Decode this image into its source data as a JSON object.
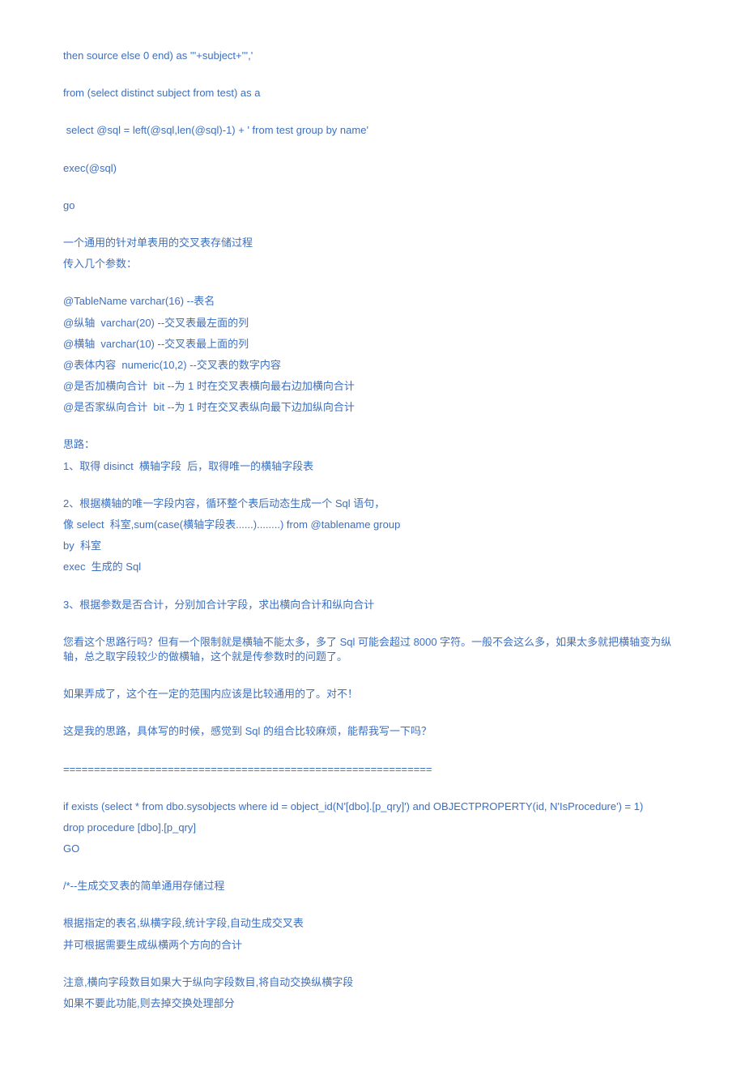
{
  "lines": [
    {
      "text": "then source else 0 end) as '''+subject+''','",
      "class": "blue line"
    },
    {
      "text": "from (select distinct subject from test) as a",
      "class": "blue line"
    },
    {
      "text": " select @sql = left(@sql,len(@sql)-1) + ' from test group by name'",
      "class": "blue line"
    },
    {
      "text": "exec(@sql)",
      "class": "blue line"
    },
    {
      "text": "go",
      "class": "blue line"
    },
    {
      "text": "一个通用的针对单表用的交叉表存储过程",
      "class": "blue line tight"
    },
    {
      "text": "传入几个参数：",
      "class": "blue line"
    },
    {
      "text": "@TableName varchar(16) --表名",
      "class": "blue line tight"
    },
    {
      "text": "@纵轴  varchar(20) --交叉表最左面的列",
      "class": "blue line tight"
    },
    {
      "text": "@横轴  varchar(10) --交叉表最上面的列",
      "class": "blue line tight"
    },
    {
      "text": "@表体内容  numeric(10,2) --交叉表的数字内容",
      "class": "blue line tight"
    },
    {
      "text": "@是否加横向合计  bit --为 1 时在交叉表横向最右边加横向合计",
      "class": "blue line tight"
    },
    {
      "text": "@是否家纵向合计  bit --为 1 时在交叉表纵向最下边加纵向合计",
      "class": "blue line"
    },
    {
      "text": "思路：",
      "class": "blue line tight"
    },
    {
      "text": "1、取得 disinct  横轴字段  后，取得唯一的横轴字段表",
      "class": "blue line"
    },
    {
      "text": "2、根据横轴的唯一字段内容，循环整个表后动态生成一个 Sql 语句，",
      "class": "blue line tight"
    },
    {
      "text": "像 select  科室,sum(case(横轴字段表......)........) from @tablename group",
      "class": "blue line tight"
    },
    {
      "text": "by  科室",
      "class": "blue line tight"
    },
    {
      "text": "exec  生成的 Sql",
      "class": "blue line"
    },
    {
      "text": "3、根据参数是否合计，分别加合计字段，求出横向合计和纵向合计",
      "class": "blue line"
    },
    {
      "text": "您看这个思路行吗？但有一个限制就是横轴不能太多，多了 Sql 可能会超过 8000 字符。一般不会这么多，如果太多就把横轴变为纵轴，总之取字段较少的做横轴，这个就是传参数时的问题了。",
      "class": "blue line"
    },
    {
      "text": "如果弄成了，这个在一定的范围内应该是比较通用的了。对不！",
      "class": "blue line"
    },
    {
      "text": "这是我的思路，具体写的时候，感觉到 Sql 的组合比较麻烦，能帮我写一下吗？",
      "class": "blue line"
    },
    {
      "text": "============================================================",
      "class": "blue line"
    },
    {
      "text": "if exists (select * from dbo.sysobjects where id = object_id(N'[dbo].[p_qry]') and OBJECTPROPERTY(id, N'IsProcedure') = 1)",
      "class": "blue line tight"
    },
    {
      "text": "drop procedure [dbo].[p_qry]",
      "class": "blue line tight"
    },
    {
      "text": "GO",
      "class": "blue line"
    },
    {
      "text": "/*--生成交叉表的简单通用存储过程",
      "class": "blue line"
    },
    {
      "text": "根据指定的表名,纵横字段,统计字段,自动生成交叉表",
      "class": "blue line tight"
    },
    {
      "text": "并可根据需要生成纵横两个方向的合计",
      "class": "blue line"
    },
    {
      "text": "注意,横向字段数目如果大于纵向字段数目,将自动交换纵横字段",
      "class": "blue line tight"
    },
    {
      "text": "如果不要此功能,则去掉交换处理部分",
      "class": "blue line tight"
    }
  ]
}
